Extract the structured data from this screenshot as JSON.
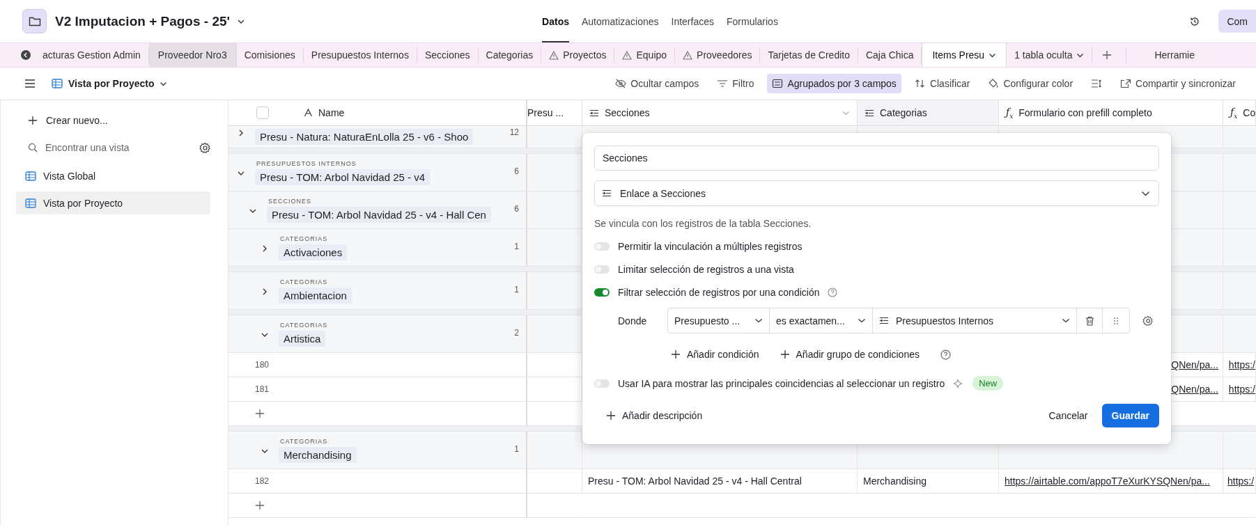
{
  "header": {
    "title": "V2 Imputacion + Pagos - 25'",
    "nav": [
      {
        "label": "Datos",
        "selected": true
      },
      {
        "label": "Automatizaciones",
        "selected": false
      },
      {
        "label": "Interfaces",
        "selected": false
      },
      {
        "label": "Formularios",
        "selected": false
      }
    ],
    "action": "Com"
  },
  "table_tabs": [
    {
      "label": "acturas Gestion Admin",
      "selected": false,
      "highlighted": false,
      "warning": false,
      "dropdown": false
    },
    {
      "label": "Proveedor Nro3",
      "selected": false,
      "highlighted": true,
      "warning": false,
      "dropdown": false
    },
    {
      "label": "Comisiones",
      "selected": false,
      "highlighted": false,
      "warning": false,
      "dropdown": false
    },
    {
      "label": "Presupuestos Internos",
      "selected": false,
      "highlighted": false,
      "warning": false,
      "dropdown": false
    },
    {
      "label": "Secciones",
      "selected": false,
      "highlighted": false,
      "warning": false,
      "dropdown": false
    },
    {
      "label": "Categorias",
      "selected": false,
      "highlighted": false,
      "warning": false,
      "dropdown": false
    },
    {
      "label": "Proyectos",
      "selected": false,
      "highlighted": false,
      "warning": true,
      "dropdown": false
    },
    {
      "label": "Equipo",
      "selected": false,
      "highlighted": false,
      "warning": true,
      "dropdown": false
    },
    {
      "label": "Proveedores",
      "selected": false,
      "highlighted": false,
      "warning": true,
      "dropdown": false
    },
    {
      "label": "Tarjetas de Credito",
      "selected": false,
      "highlighted": false,
      "warning": false,
      "dropdown": false
    },
    {
      "label": "Caja Chica",
      "selected": false,
      "highlighted": false,
      "warning": false,
      "dropdown": false
    },
    {
      "label": "Items Presu",
      "selected": true,
      "highlighted": false,
      "warning": false,
      "dropdown": true
    },
    {
      "label": "1 tabla oculta",
      "selected": false,
      "highlighted": false,
      "warning": false,
      "dropdown": true
    }
  ],
  "tools_tab": "Herramie",
  "toolbar": {
    "view": "Vista por Proyecto",
    "actions": [
      {
        "kind": "hide",
        "label": "Ocultar campos",
        "active": false
      },
      {
        "kind": "filter",
        "label": "Filtro",
        "active": false
      },
      {
        "kind": "group",
        "label": "Agrupados por 3 campos",
        "active": true
      },
      {
        "kind": "sort",
        "label": "Clasificar",
        "active": false
      },
      {
        "kind": "color",
        "label": "Configurar color",
        "active": false
      },
      {
        "kind": "height",
        "active": false
      },
      {
        "kind": "share",
        "label": "Compartir y sincronizar",
        "active": false
      }
    ]
  },
  "sidebar": {
    "create": "Crear nuevo...",
    "search_placeholder": "Encontrar una vista",
    "views": [
      {
        "label": "Vista Global",
        "selected": false
      },
      {
        "label": "Vista por Proyecto",
        "selected": true
      }
    ]
  },
  "table": {
    "select_all_checked": false,
    "columns": [
      {
        "label": "Name",
        "kind": "primary"
      },
      {
        "label": "Presu ...",
        "kind": "plain"
      },
      {
        "label": "Secciones",
        "kind": "link"
      },
      {
        "label": "Categorias",
        "kind": "link"
      },
      {
        "label": "Formulario con prefill completo",
        "kind": "formula",
        "symbol": "ƒ$_{x}$"
      },
      {
        "label": "Co",
        "kind": "formula",
        "symbol": "ƒ$_{x}$"
      }
    ],
    "groups": [
      {
        "title": "Presu - Natura: NaturaEnLolla 25 - v6 - Shoo",
        "count": "12",
        "expanded": false
      },
      {
        "field": "PRESUPUESTOS INTERNOS",
        "title": "Presu - TOM: Arbol Navidad 25 - v4",
        "count": "6",
        "expanded": true,
        "children": [
          {
            "field": "SECCIONES",
            "title": "Presu - TOM: Arbol Navidad 25 - v4 - Hall Cen",
            "count": "6",
            "expanded": true,
            "children": [
              {
                "field": "CATEGORIAS",
                "title": "Activaciones",
                "count": "1",
                "expanded": false
              },
              {
                "field": "CATEGORIAS",
                "title": "Ambientacion",
                "count": "1",
                "expanded": false
              },
              {
                "field": "CATEGORIAS",
                "title": "Artistica",
                "count": "2",
                "expanded": true,
                "records": [
                  {
                    "number": "180",
                    "under_dialog": true,
                    "cells": {
                      "4": "QNen/pa...",
                      "5": "https:/"
                    }
                  },
                  {
                    "number": "181",
                    "under_dialog": true,
                    "cells": {
                      "4": "QNen/pa...",
                      "5": "https:/"
                    }
                  }
                ]
              },
              {
                "field": "CATEGORIAS",
                "title": "Merchandising",
                "count": "1",
                "expanded": true,
                "records": [
                  {
                    "number": "182",
                    "under_dialog": false,
                    "cells": {
                      "2": "Presu - TOM: Arbol Navidad 25 - v4 - Hall Central",
                      "3": "Merchandising",
                      "4": "https://airtable.com/appoT7eXurKYSQNen/pa...",
                      "5": "https:/"
                    }
                  }
                ]
              }
            ]
          }
        ]
      }
    ]
  },
  "field_editor": {
    "name_value": "Secciones",
    "type": "Enlace a Secciones",
    "description": "Se vincula con los registros de la tabla Secciones.",
    "options": [
      {
        "label": "Permitir la vinculación a múltiples registros",
        "on": false
      },
      {
        "label": "Limitar selección de registros a una vista",
        "on": false
      },
      {
        "label": "Filtrar selección de registros por una condición",
        "on": true,
        "help": true
      }
    ],
    "condition": {
      "prefix": "Donde",
      "field": "Presupuesto ...",
      "operator": "es exactamen...",
      "value": "Presupuestos Internos"
    },
    "add_condition": "Añadir condición",
    "add_group": "Añadir grupo de condiciones",
    "ai_option": {
      "label": "Usar IA para mostrar las principales coincidencias al seleccionar un registro",
      "on": false,
      "badge": "New"
    },
    "add_description": "Añadir descripción",
    "cancel": "Cancelar",
    "save": "Guardar"
  }
}
